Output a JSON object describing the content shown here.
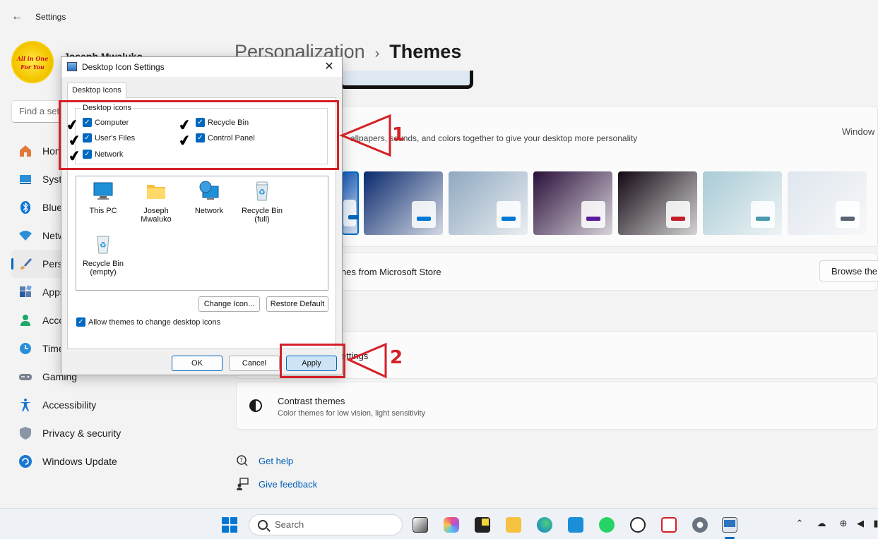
{
  "window": {
    "title": "Settings"
  },
  "profile": {
    "name": "Joseph Mwaluko",
    "avatar_line1": "All in One",
    "avatar_line2": "For You"
  },
  "search": {
    "placeholder": "Find a setting"
  },
  "nav": {
    "items": [
      {
        "label": "Home",
        "icon": "home-icon"
      },
      {
        "label": "System",
        "icon": "system-icon"
      },
      {
        "label": "Bluetooth & devices",
        "icon": "bluetooth-icon"
      },
      {
        "label": "Network & internet",
        "icon": "wifi-icon"
      },
      {
        "label": "Personalization",
        "icon": "brush-icon",
        "active": true
      },
      {
        "label": "Apps",
        "icon": "apps-icon"
      },
      {
        "label": "Accounts",
        "icon": "accounts-icon"
      },
      {
        "label": "Time & language",
        "icon": "clock-icon"
      },
      {
        "label": "Gaming",
        "icon": "gamepad-icon"
      },
      {
        "label": "Accessibility",
        "icon": "accessibility-icon"
      },
      {
        "label": "Privacy & security",
        "icon": "shield-icon"
      },
      {
        "label": "Windows Update",
        "icon": "update-icon"
      }
    ]
  },
  "header": {
    "crumb": "Personalization",
    "separator": "›",
    "title": "Themes"
  },
  "themes": {
    "description": "allpapers, sounds, and colors together to give your desktop more personality",
    "current_label": "Window",
    "thumb_colors": [
      "#1e5db8",
      "#0a2a6e",
      "#8fa8c0",
      "#2a0f3a",
      "#120812",
      "#a9cbd6",
      "#dfe6ee"
    ],
    "chip_colors": [
      "#0067c0",
      "#0078d4",
      "#0078d4",
      "#5b1c9c",
      "#c41c2a",
      "#4a9ab0",
      "#5a6470"
    ]
  },
  "store": {
    "label": "nes from Microsoft Store",
    "button": "Browse the"
  },
  "desktop_icon_settings_row": {
    "label": "ettings"
  },
  "contrast": {
    "title": "Contrast themes",
    "subtitle": "Color themes for low vision, light sensitivity"
  },
  "help": {
    "get_help": "Get help",
    "give_feedback": "Give feedback"
  },
  "dialog": {
    "title": "Desktop Icon Settings",
    "close": "✕",
    "tab": "Desktop Icons",
    "group_label": "Desktop icons",
    "checkboxes": [
      {
        "label": "Computer",
        "checked": true
      },
      {
        "label": "Recycle Bin",
        "checked": true
      },
      {
        "label": "User's Files",
        "checked": true
      },
      {
        "label": "Control Panel",
        "checked": true
      },
      {
        "label": "Network",
        "checked": true
      }
    ],
    "icons": [
      {
        "label": "This PC"
      },
      {
        "label": "Joseph Mwaluko"
      },
      {
        "label": "Network"
      },
      {
        "label": "Recycle Bin (full)"
      },
      {
        "label": "Recycle Bin (empty)"
      }
    ],
    "change_icon": "Change Icon...",
    "restore_default": "Restore Default",
    "allow_themes": "Allow themes to change desktop icons",
    "ok": "OK",
    "cancel": "Cancel",
    "apply": "Apply"
  },
  "annotations": {
    "one": "1",
    "two": "2",
    "color": "#d42027"
  },
  "taskbar": {
    "search_placeholder": "Search"
  }
}
